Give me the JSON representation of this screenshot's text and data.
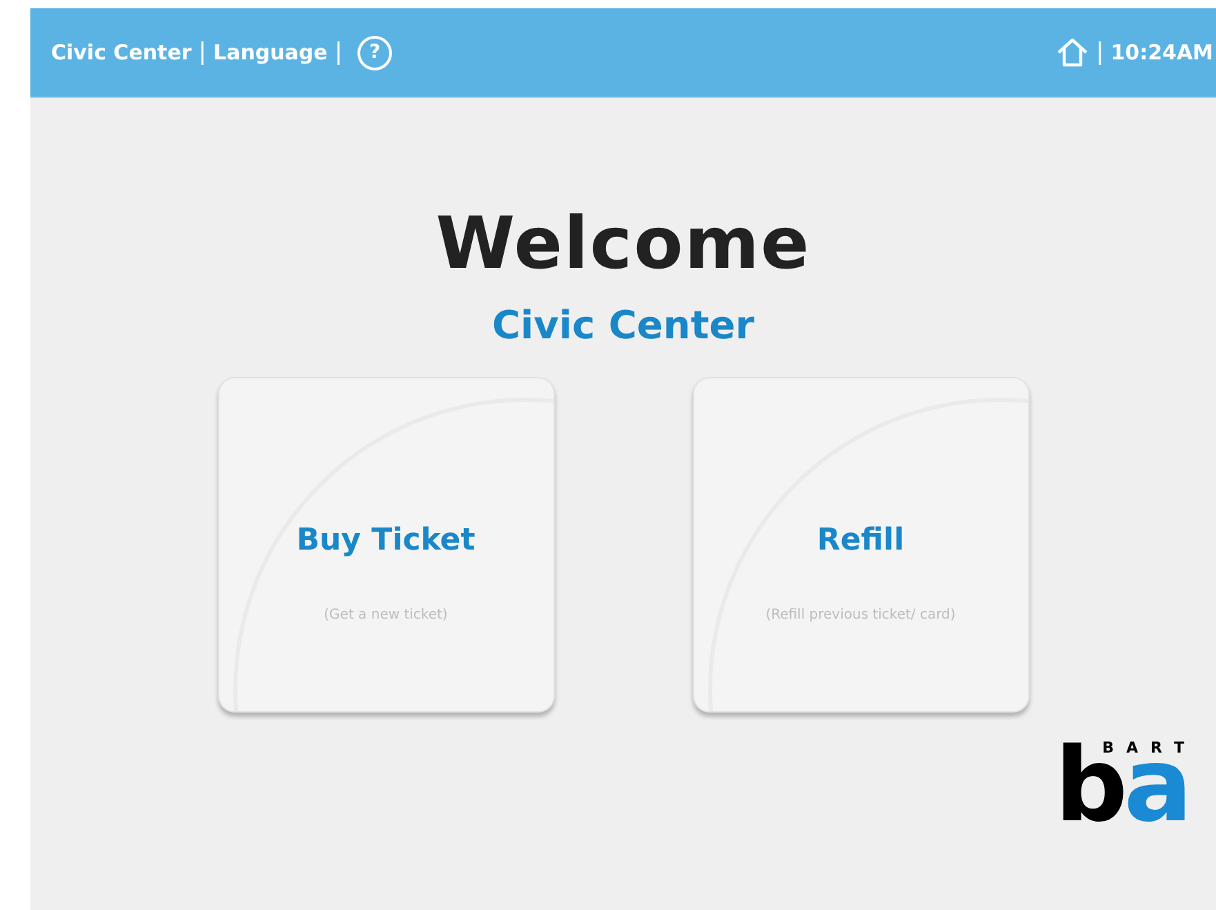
{
  "top_bar": {
    "station": "Civic Center",
    "separator_1": "|",
    "language": "Language",
    "separator_2": "|",
    "help": "?",
    "separator_3": "|",
    "time": "10:24AM"
  },
  "heading": "Welcome",
  "station_name": "Civic Center",
  "options": [
    {
      "title": "Buy Ticket",
      "subtitle": "(Get a new ticket)"
    },
    {
      "title": "Refill",
      "subtitle": "(Refill previous ticket/ card)"
    }
  ],
  "logo": {
    "caption": "BART",
    "letters": [
      "b",
      "a"
    ]
  }
}
